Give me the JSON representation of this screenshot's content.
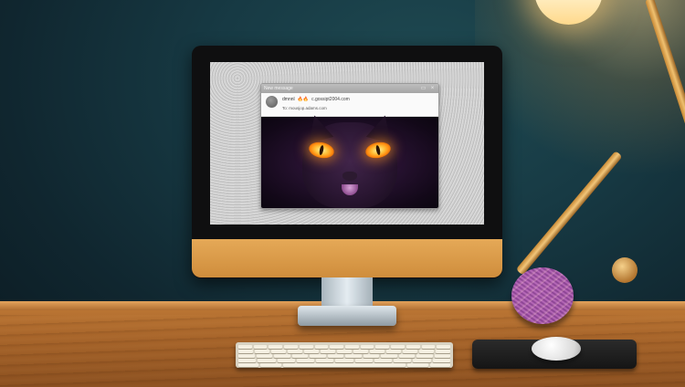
{
  "email_window": {
    "title": "New message",
    "window_buttons": [
      "▭",
      "×"
    ],
    "from_name": "dmnnl",
    "from_emoji": "🔥🔥",
    "from_email": "c.gossipt2004.com",
    "to_line": "To: mousjop.adams.com"
  },
  "scene": {
    "accent_lamp": "#ffd98c",
    "desk_color": "#a8652a",
    "imac_chin_color": "#d89b4a"
  }
}
